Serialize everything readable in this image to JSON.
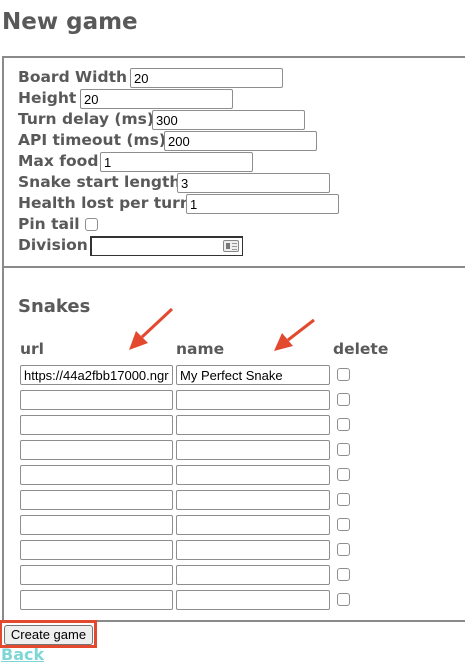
{
  "page_title": "New game",
  "settings": {
    "board_width": {
      "label": "Board Width",
      "value": "20"
    },
    "height": {
      "label": "Height",
      "value": "20"
    },
    "turn_delay": {
      "label": "Turn delay (ms)",
      "value": "300"
    },
    "api_timeout": {
      "label": "API timeout (ms)",
      "value": "200"
    },
    "max_food": {
      "label": "Max food",
      "value": "1"
    },
    "snake_start_length": {
      "label": "Snake start length",
      "value": "3"
    },
    "health_lost": {
      "label": "Health lost per turn",
      "value": "1"
    },
    "pin_tail": {
      "label": "Pin tail",
      "checked": false
    },
    "division": {
      "label": "Division",
      "value": ""
    }
  },
  "snakes": {
    "title": "Snakes",
    "columns": {
      "url": "url",
      "name": "name",
      "delete": "delete"
    },
    "rows": [
      {
        "url": "https://44a2fbb17000.ngr",
        "name": "My Perfect Snake"
      },
      {
        "url": "",
        "name": ""
      },
      {
        "url": "",
        "name": ""
      },
      {
        "url": "",
        "name": ""
      },
      {
        "url": "",
        "name": ""
      },
      {
        "url": "",
        "name": ""
      },
      {
        "url": "",
        "name": ""
      },
      {
        "url": "",
        "name": ""
      },
      {
        "url": "",
        "name": ""
      },
      {
        "url": "",
        "name": ""
      }
    ]
  },
  "create_button": "Create game",
  "back_link": "Back",
  "colors": {
    "annotation_red": "#e3492f",
    "link": "#7fd6d6",
    "label": "#595959"
  }
}
